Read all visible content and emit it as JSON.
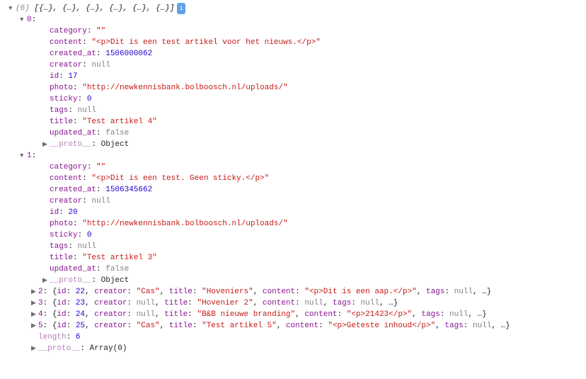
{
  "header": {
    "count": "(6)",
    "preview": "[{…}, {…}, {…}, {…}, {…}, {…}]",
    "badge": "i"
  },
  "items": [
    {
      "index": "0",
      "expanded": true,
      "props": {
        "category": "\"\"",
        "content": "\"<p>Dit is een test artikel voor het nieuws.</p>\"",
        "created_at": "1506000062",
        "creator": "null",
        "id": "17",
        "photo": "\"http://newkennisbank.bolboosch.nl/uploads/\"",
        "sticky": "0",
        "tags": "null",
        "title": "\"Test artikel 4\"",
        "updated_at": "false"
      },
      "proto": "Object"
    },
    {
      "index": "1",
      "expanded": true,
      "props": {
        "category": "\"\"",
        "content": "\"<p>Dit is een test. Geen sticky.</p>\"",
        "created_at": "1506345662",
        "creator": "null",
        "id": "20",
        "photo": "\"http://newkennisbank.bolboosch.nl/uploads/\"",
        "sticky": "0",
        "tags": "null",
        "title": "\"Test artikel 3\"",
        "updated_at": "false"
      },
      "proto": "Object"
    }
  ],
  "collapsed": [
    {
      "index": "2",
      "id": "22",
      "creator": "\"Cas\"",
      "title": "\"Hoveniers\"",
      "content": "\"<p>Dit is een aap.</p>\"",
      "tags": "null"
    },
    {
      "index": "3",
      "id": "23",
      "creator": "null",
      "title": "\"Hovenier 2\"",
      "content": "null",
      "tags": "null"
    },
    {
      "index": "4",
      "id": "24",
      "creator": "null",
      "title": "\"B&B nieuwe branding\"",
      "content": "\"<p>21423</p>\"",
      "tags": "null"
    },
    {
      "index": "5",
      "id": "25",
      "creator": "\"Cas\"",
      "title": "\"Test artikel 5\"",
      "content": "\"<p>Geteste inhoud</p>\"",
      "tags": "null"
    }
  ],
  "footer": {
    "length_key": "length",
    "length_val": "6",
    "proto_key": "__proto__",
    "proto_val": "Array(0)"
  },
  "labels": {
    "category": "category",
    "content": "content",
    "created_at": "created_at",
    "creator": "creator",
    "id": "id",
    "photo": "photo",
    "sticky": "sticky",
    "tags": "tags",
    "title": "title",
    "updated_at": "updated_at",
    "proto": "__proto__"
  }
}
